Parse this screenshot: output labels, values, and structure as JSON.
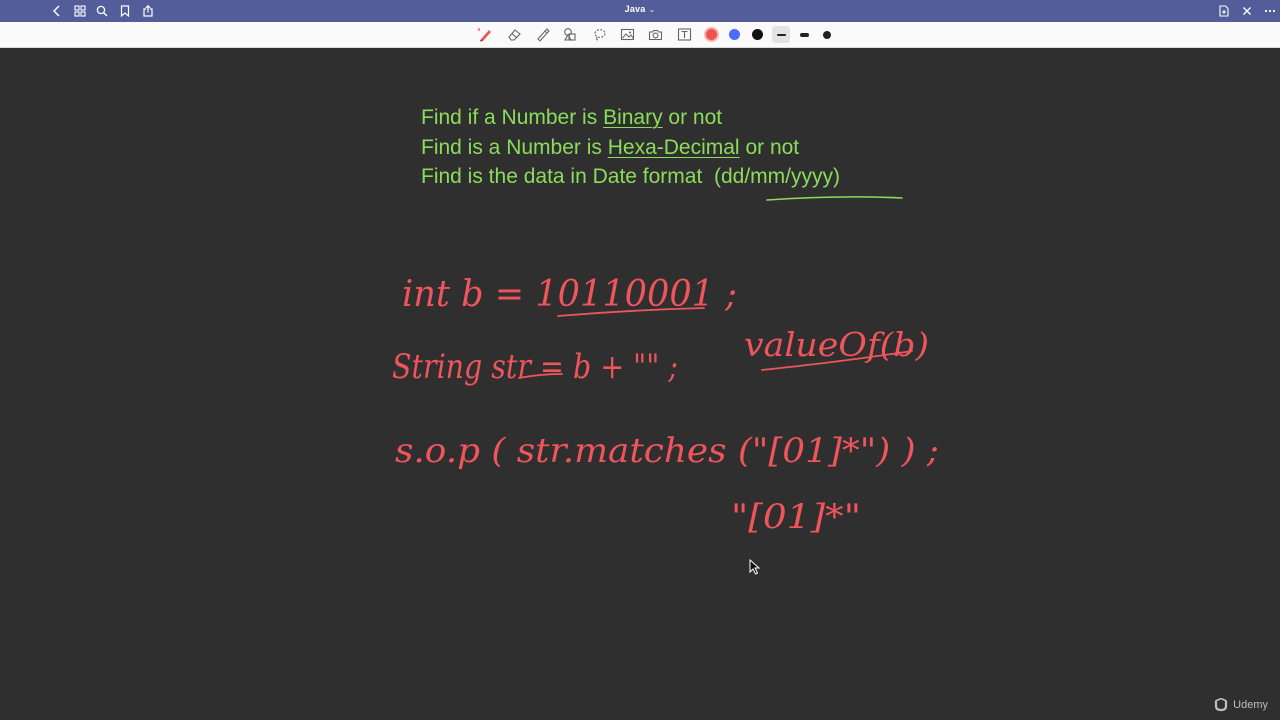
{
  "app": {
    "document_title": "Java",
    "title_caret": "⌄",
    "titlebar_left_icons": [
      "back-icon",
      "grid-icon",
      "search-icon",
      "bookmark-icon",
      "share-icon"
    ],
    "titlebar_right_icons": [
      "new-page-icon",
      "close-icon",
      "more-icon"
    ]
  },
  "toolbar": {
    "tools": [
      "pen-tool",
      "eraser-tool",
      "highlighter-tool",
      "shapes-tool",
      "lasso-tool",
      "image-tool",
      "camera-tool",
      "text-tool"
    ],
    "colors": [
      {
        "name": "red",
        "hex": "#ef5350",
        "selected": true
      },
      {
        "name": "blue",
        "hex": "#4a6cf7",
        "selected": false
      },
      {
        "name": "black",
        "hex": "#111111",
        "selected": false
      }
    ],
    "thicknesses": [
      "thin",
      "medium",
      "thick"
    ],
    "selected_thickness": "thin"
  },
  "notes": {
    "line1": {
      "pre": "Find if a Number is ",
      "underlined": "Binary",
      "post": " or not"
    },
    "line2": {
      "pre": "Find is a Number is ",
      "underlined": "Hexa-Decimal",
      "post": " or not"
    },
    "line3": {
      "pre": "Find is the data in Date format  ",
      "bracket": "(dd/mm/yyyy)"
    },
    "text_color": "#8bdc5a"
  },
  "handwriting": {
    "ink_color": "#f0555c",
    "line1": "int  b = 10110001 ;",
    "line2": "String  str = b + \"\" ;",
    "line2_note": "valueOf(b)",
    "line3": "s.o.p ( str.matches (\"[01]*\") ) ;",
    "line4": "\"[01]*\""
  },
  "brand": {
    "name": "Udemy"
  }
}
